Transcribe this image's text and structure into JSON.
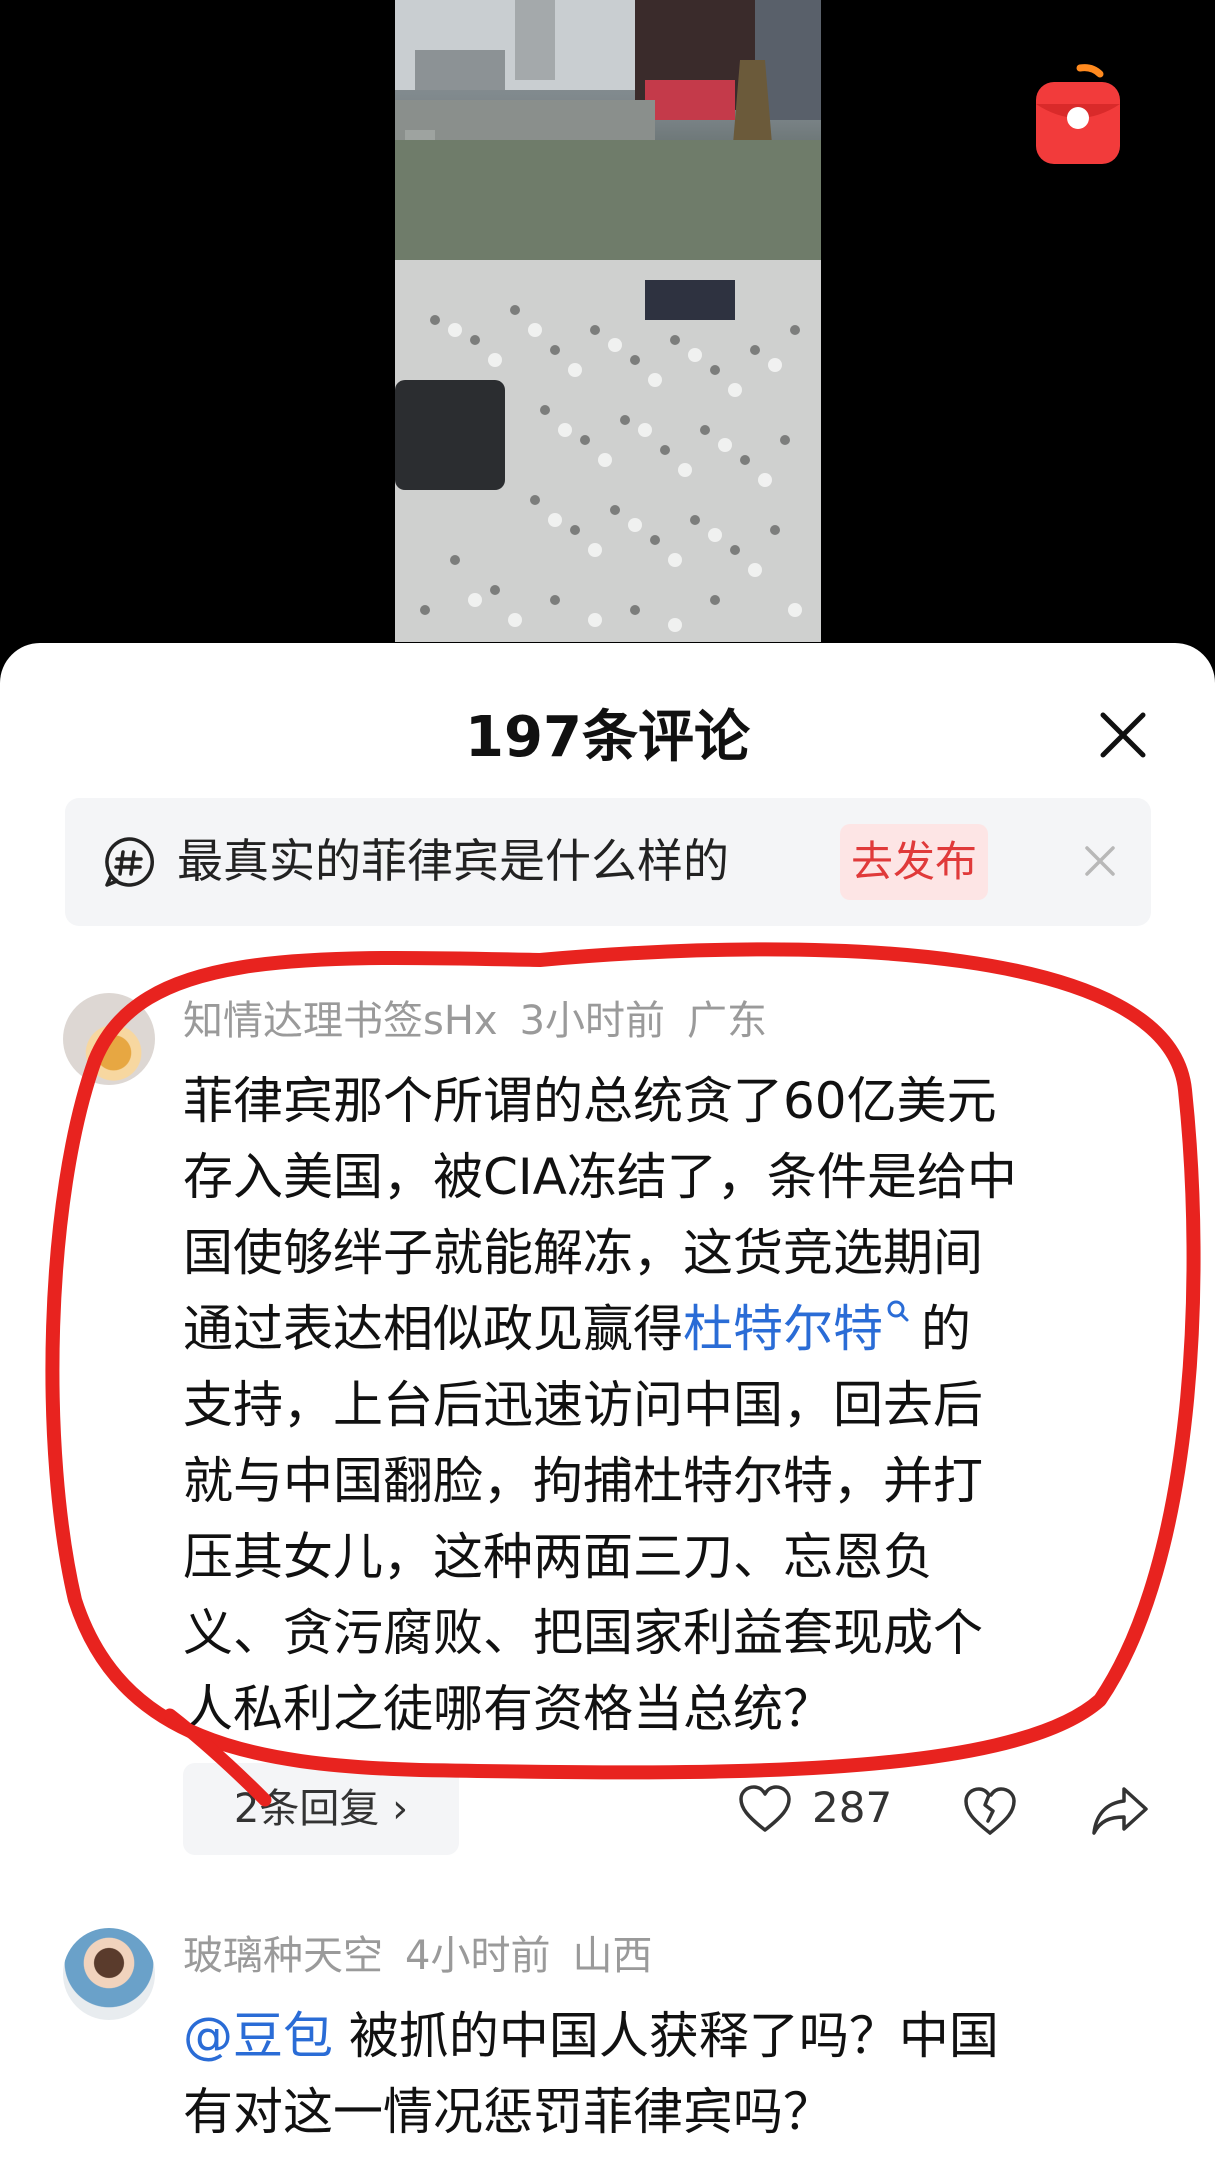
{
  "comments_header": {
    "title": "197条评论"
  },
  "topic_bar": {
    "topic": "最真实的菲律宾是什么样的",
    "post_label": "去发布"
  },
  "comments": [
    {
      "username": "知情达理书签sHx",
      "time": "3小时前",
      "location": "广东",
      "text_lines": [
        "菲律宾那个所谓的总统贪了60亿美元",
        "存入美国，被CIA冻结了，条件是给中",
        "国使够绊子就能解冻，这货竞选期间",
        "通过表达相似政见赢得",
        "的",
        "支持，上台后迅速访问中国，回去后",
        "就与中国翻脸，拘捕杜特尔特，并打",
        "压其女儿，这种两面三刀、忘恩负",
        "义、贪污腐败、把国家利益套现成个",
        "人私利之徒哪有资格当总统？"
      ],
      "linked_term": "杜特尔特",
      "replies_label": "2条回复 ›",
      "likes": "287"
    },
    {
      "username": "玻璃种天空",
      "time": "4小时前",
      "location": "山西",
      "mention": "@豆包",
      "text_lines": [
        " 被抓的中国人获释了吗？中国",
        "有对这一情况惩罚菲律宾吗？"
      ]
    }
  ],
  "icons": {
    "close": "close-icon",
    "topic": "hashtag-icon",
    "like": "heart-icon",
    "dislike": "broken-heart-icon",
    "share": "share-icon",
    "search": "search-icon",
    "red_packet": "red-packet-icon"
  },
  "colors": {
    "accent": "#e03a3a",
    "link": "#2a6cd6",
    "annotation": "#e8231f"
  }
}
